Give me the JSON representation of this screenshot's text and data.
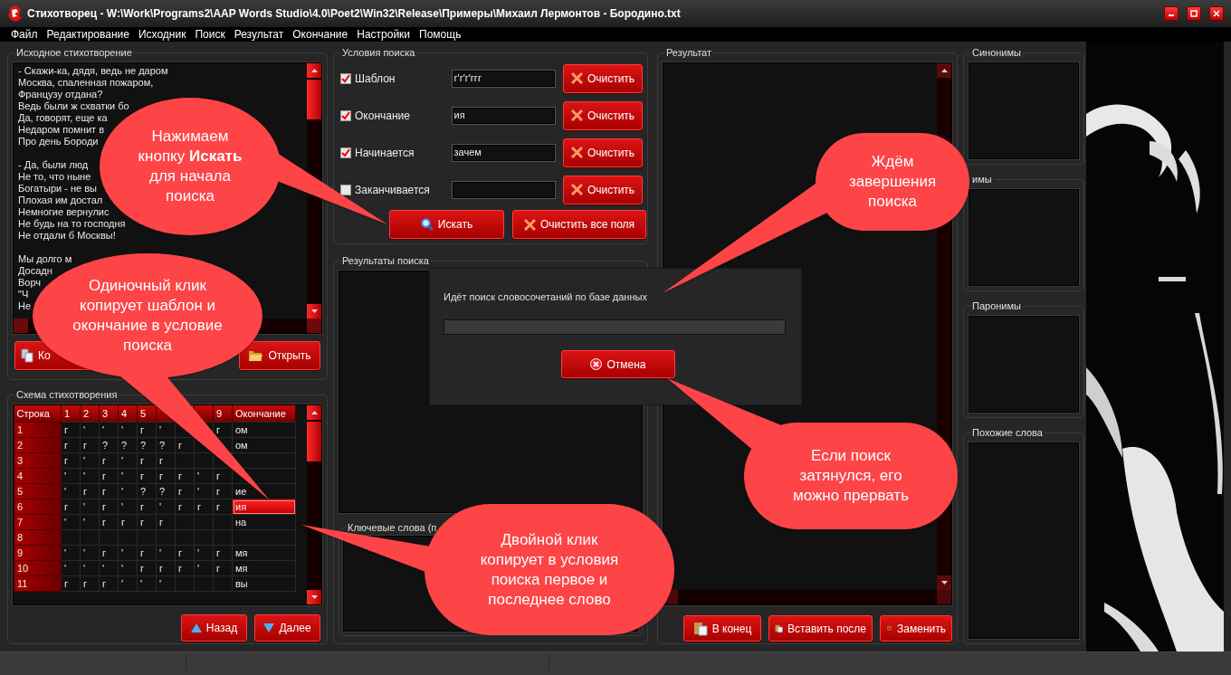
{
  "window": {
    "title": "Стихотворец - W:\\Work\\Programs2\\AAP Words Studio\\4.0\\Poet2\\Win32\\Release\\Примеры\\Михаил Лермонтов - Бородино.txt"
  },
  "menu": [
    "Файл",
    "Редактирование",
    "Исходник",
    "Поиск",
    "Результат",
    "Окончание",
    "Настройки",
    "Помощь"
  ],
  "source": {
    "title": "Исходное стихотворение",
    "stanzas": [
      [
        "- Скажи-ка, дядя, ведь не даром",
        "Москва, спаленная пожаром,",
        "Французу отдана?",
        "Ведь были ж схватки бо",
        "Да, говорят, еще ка",
        "Недаром помнит в",
        "Про день Бороди"
      ],
      [
        "- Да, были люд",
        "Не то, что ныне",
        "Богатыри - не вы",
        "Плохая им достал",
        "Немногие вернулис",
        "Не будь на то господня",
        "Не отдали б Москвы!"
      ],
      [
        "Мы долго м",
        "Досадн",
        "Ворч",
        "\"Ч",
        "Не"
      ]
    ],
    "buttons": [
      {
        "label": "Ко"
      },
      {
        "label": "Открыть"
      }
    ]
  },
  "scheme": {
    "title": "Схема стихотворения",
    "columns": [
      "Строка",
      "1",
      "2",
      "3",
      "4",
      "5",
      "",
      "",
      "",
      "9",
      "Окончание"
    ],
    "rows": [
      {
        "cells": [
          "1",
          "г",
          "'",
          "'",
          "'",
          "г",
          "'",
          "",
          "",
          "г",
          "ом"
        ],
        "selected": false
      },
      {
        "cells": [
          "2",
          "г",
          "г",
          "?",
          "?",
          "?",
          "?",
          "г",
          "",
          "",
          "ом"
        ],
        "selected": false
      },
      {
        "cells": [
          "3",
          "г",
          "'",
          "г",
          "'",
          "г",
          "г",
          "",
          "",
          "",
          ""
        ],
        "selected": false
      },
      {
        "cells": [
          "4",
          "'",
          "'",
          "г",
          "'",
          "г",
          "г",
          "г",
          "'",
          "г",
          ""
        ],
        "selected": false
      },
      {
        "cells": [
          "5",
          "'",
          "г",
          "г",
          "'",
          "?",
          "?",
          "г",
          "'",
          "г",
          "ие"
        ],
        "selected": false
      },
      {
        "cells": [
          "6",
          "г",
          "'",
          "г",
          "'",
          "г",
          "'",
          "г",
          "г",
          "г",
          "ия"
        ],
        "selected": true
      },
      {
        "cells": [
          "7",
          "'",
          "'",
          "г",
          "г",
          "г",
          "г",
          "",
          "",
          "",
          "на"
        ],
        "selected": false
      },
      {
        "cells": [
          "8",
          "",
          "",
          "",
          "",
          "",
          "",
          "",
          "",
          "",
          ""
        ],
        "selected": false
      },
      {
        "cells": [
          "9",
          "'",
          "'",
          "г",
          "'",
          "г",
          "'",
          "г",
          "'",
          "г",
          "мя"
        ],
        "selected": false
      },
      {
        "cells": [
          "10",
          "'",
          "'",
          "'",
          "'",
          "г",
          "г",
          "г",
          "'",
          "г",
          "мя"
        ],
        "selected": false
      },
      {
        "cells": [
          "11",
          "г",
          "г",
          "г",
          "'",
          "'",
          "'",
          "",
          "",
          "",
          "вы"
        ],
        "selected": false
      }
    ],
    "buttons": [
      {
        "label": "Назад"
      },
      {
        "label": "Далее"
      }
    ]
  },
  "conditions": {
    "title": "Условия поиска",
    "rows": [
      {
        "label": "Шаблон",
        "checked": true,
        "value": "г'г'г'ггг",
        "button": "Очистить"
      },
      {
        "label": "Окончание",
        "checked": true,
        "value": "ия",
        "button": "Очистить"
      },
      {
        "label": "Начинается",
        "checked": true,
        "value": "зачем",
        "button": "Очистить"
      },
      {
        "label": "Заканчивается",
        "checked": false,
        "button": "Очистить"
      }
    ],
    "buttons": [
      {
        "label": "Искать"
      },
      {
        "label": "Очистить все поля"
      }
    ]
  },
  "search_results": {
    "title": "Результаты поиска",
    "keywords_title": "Ключевые слова (п"
  },
  "result": {
    "title": "Результат",
    "buttons": [
      {
        "label": "В конец"
      },
      {
        "label": "Вставить после"
      },
      {
        "label": "Заменить"
      }
    ]
  },
  "side_panels": [
    {
      "title": "Синонимы"
    },
    {
      "title": "имы"
    },
    {
      "title": "Паронимы"
    },
    {
      "title": "Похожие слова"
    }
  ],
  "dialog": {
    "message": "Идёт поиск словосочетаний по базе данных",
    "progress": {
      "level": 0
    },
    "button": {
      "label": "Отмена"
    }
  },
  "callouts": [
    {
      "text": "Нажимаем кнопку **Искать** для начала поиска"
    },
    {
      "text": "Одиночный клик копирует шаблон и окончание в условие поиска"
    },
    {
      "text": "Ждём завершения поиска"
    },
    {
      "text": "Если поиск затянулся, его можно прервать"
    },
    {
      "text": "Двойной клик копирует в условия поиска первое и последнее слово"
    }
  ]
}
